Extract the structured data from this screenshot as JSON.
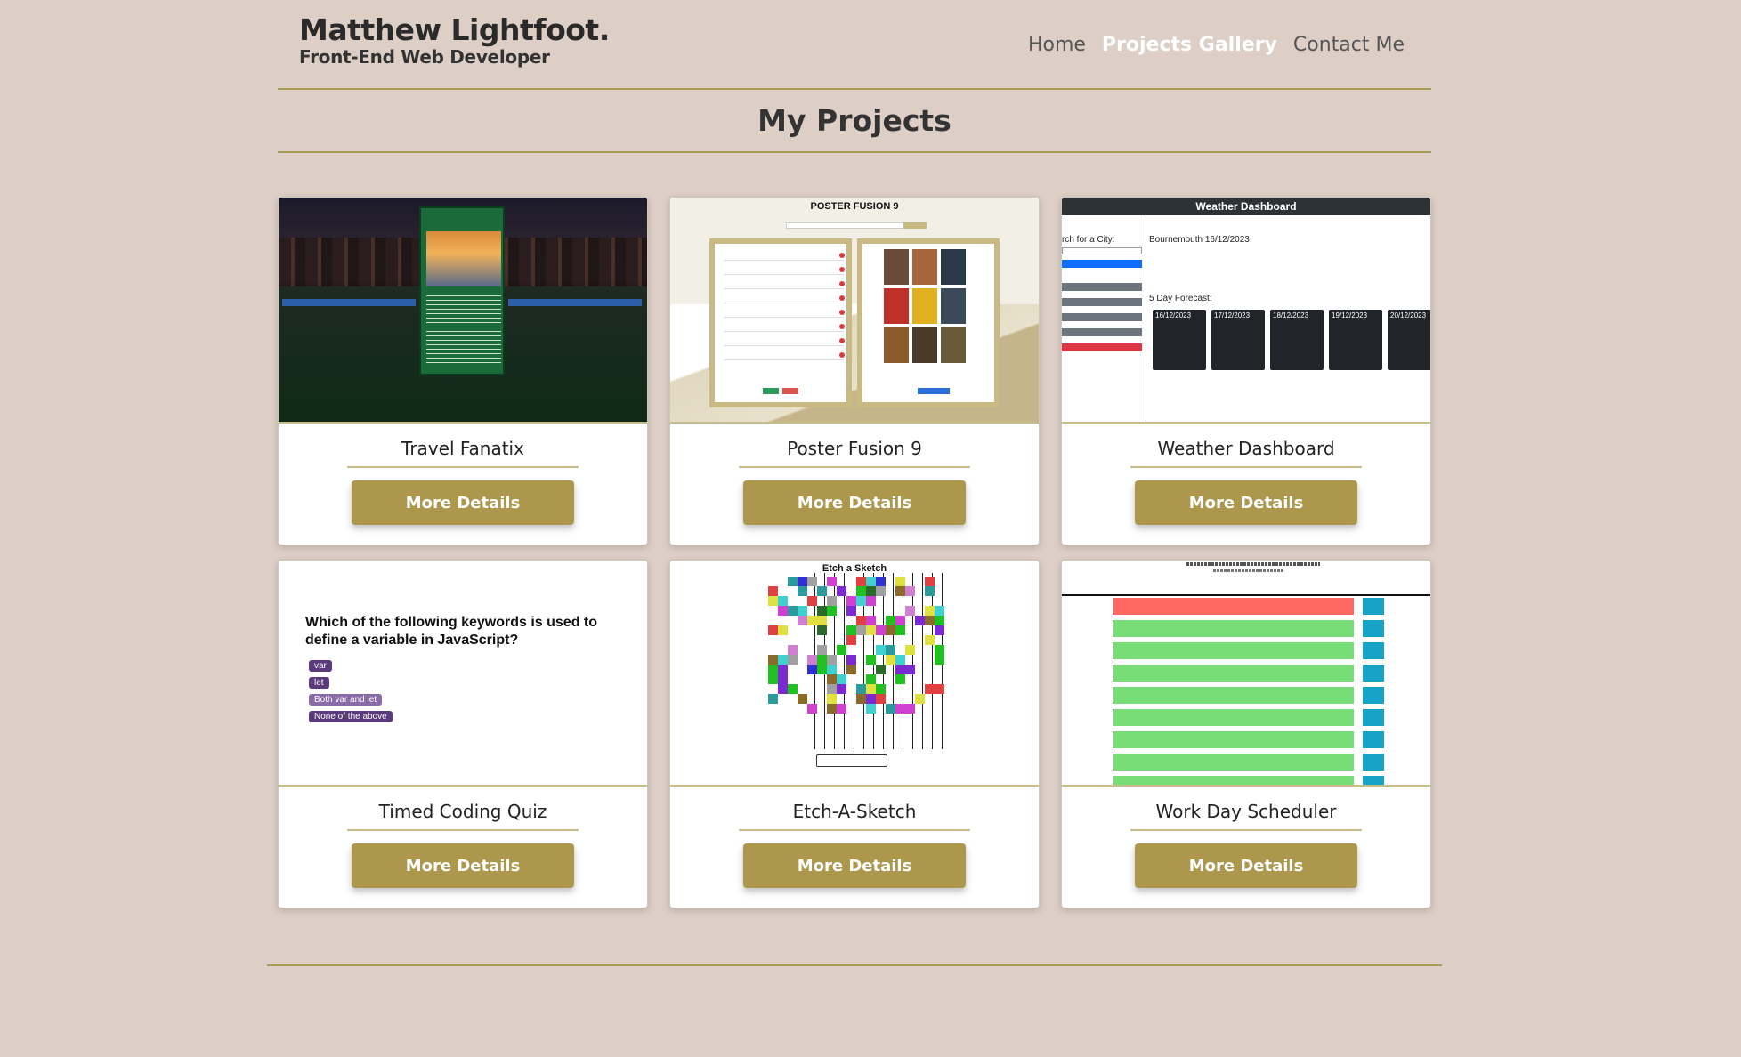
{
  "header": {
    "name": "Matthew Lightfoot.",
    "subtitle": "Front-End Web Developer",
    "nav": [
      {
        "label": "Home",
        "active": false
      },
      {
        "label": "Projects Gallery",
        "active": true
      },
      {
        "label": "Contact Me",
        "active": false
      }
    ]
  },
  "page": {
    "title": "My Projects"
  },
  "projects": [
    {
      "title": "Travel Fanatix",
      "button": "More Details",
      "thumb": "travel-fanatix-screenshot"
    },
    {
      "title": "Poster Fusion 9",
      "button": "More Details",
      "thumb": "poster-fusion-screenshot"
    },
    {
      "title": "Weather Dashboard",
      "button": "More Details",
      "thumb": "weather-dashboard-screenshot"
    },
    {
      "title": "Timed Coding Quiz",
      "button": "More Details",
      "thumb": "coding-quiz-screenshot"
    },
    {
      "title": "Etch-A-Sketch",
      "button": "More Details",
      "thumb": "etch-a-sketch-screenshot"
    },
    {
      "title": "Work Day Scheduler",
      "button": "More Details",
      "thumb": "work-day-scheduler-screenshot"
    }
  ],
  "thumbs": {
    "poster_fusion": {
      "heading": "POSTER FUSION 9"
    },
    "weather": {
      "heading": "Weather Dashboard",
      "search_label": "rch for a City:",
      "city": "Bournemouth 16/12/2023",
      "forecast_label": "5 Day Forecast:",
      "days": [
        "16/12/2023",
        "17/12/2023",
        "18/12/2023",
        "19/12/2023",
        "20/12/2023"
      ]
    },
    "quiz": {
      "question": "Which of the following keywords is used to define a variable in JavaScript?",
      "options": [
        "var",
        "let",
        "Both var and let",
        "None of the above"
      ]
    },
    "etch": {
      "heading": "Etch a Sketch"
    }
  },
  "colors": {
    "background": "#ddcfc6",
    "accent": "#ad974c",
    "nav_active": "#ffffff",
    "divider": "#a89a58"
  }
}
